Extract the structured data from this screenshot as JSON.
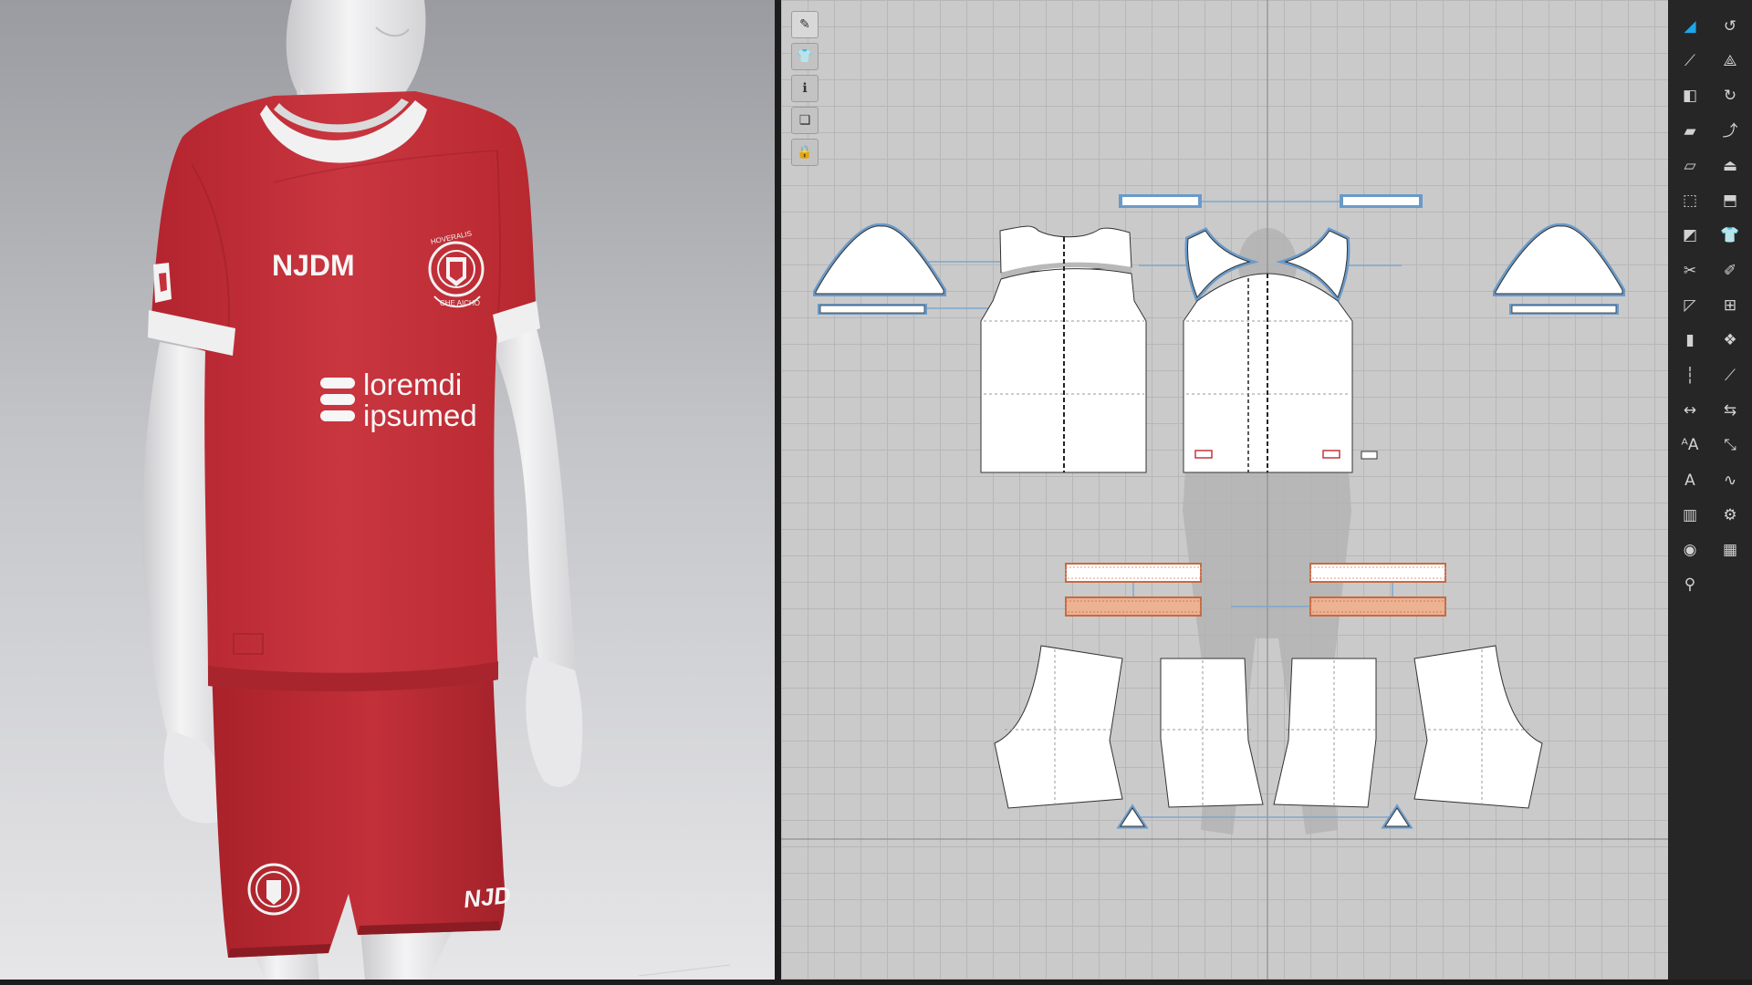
{
  "garment_3d": {
    "sponsor_chest": "NJDM",
    "sponsor_main_line1": "loremdi",
    "sponsor_main_line2": "ipsumed",
    "shorts_print": "NJD",
    "crest_text_top": "HOVERALIS",
    "crest_text_bottom": "CHE AICHO",
    "colors": {
      "fabric": "#c5313b",
      "fabric_dark": "#9e2029",
      "rib": "#eeeeee",
      "body": "#e4e4e6"
    }
  },
  "tools_2d": [
    {
      "name": "edit-pattern",
      "icon": "pen-icon",
      "glyph": "✎",
      "active": true
    },
    {
      "name": "garment-view",
      "icon": "shirt-icon",
      "glyph": "👕",
      "active": false
    },
    {
      "name": "info",
      "icon": "info-icon",
      "glyph": "ℹ",
      "active": false
    },
    {
      "name": "layers",
      "icon": "layers-icon",
      "glyph": "❏",
      "active": false
    },
    {
      "name": "lock",
      "icon": "lock-icon",
      "glyph": "🔒",
      "active": false
    }
  ],
  "tools_right": {
    "left_column": [
      {
        "icon": "select-pattern-icon",
        "glyph": "◢",
        "active": true
      },
      {
        "icon": "transform-icon",
        "glyph": "⟋",
        "active": false
      },
      {
        "icon": "polygon-icon",
        "glyph": "◧",
        "active": false
      },
      {
        "icon": "rectangle-icon",
        "glyph": "▰",
        "active": false
      },
      {
        "icon": "internal-shape-icon",
        "glyph": "▱",
        "active": false
      },
      {
        "icon": "dashed-rect-icon",
        "glyph": "⬚",
        "active": false
      },
      {
        "icon": "cut-pattern-icon",
        "glyph": "◩",
        "active": false
      },
      {
        "icon": "scissors-icon",
        "glyph": "✂",
        "active": false
      },
      {
        "icon": "dart-icon",
        "glyph": "◸",
        "active": false
      },
      {
        "icon": "fold-icon",
        "glyph": "▮",
        "active": false
      },
      {
        "icon": "ruler-vertical-icon",
        "glyph": "┆",
        "active": false
      },
      {
        "icon": "measure-icon",
        "glyph": "↔",
        "active": false
      },
      {
        "icon": "annotation-a-icon",
        "glyph": "ᴬA",
        "active": false
      },
      {
        "icon": "text-tool-icon",
        "glyph": "A",
        "active": false
      },
      {
        "icon": "grid-pattern-icon",
        "glyph": "▥",
        "active": false
      },
      {
        "icon": "button-icon",
        "glyph": "◉",
        "active": false
      },
      {
        "icon": "pin-icon",
        "glyph": "⚲",
        "active": false
      }
    ],
    "right_column": [
      {
        "icon": "move-pattern-icon",
        "glyph": "↺",
        "active": false
      },
      {
        "icon": "curve-point-icon",
        "glyph": "⟁",
        "active": false
      },
      {
        "icon": "rotate-icon",
        "glyph": "↻",
        "active": false
      },
      {
        "icon": "arrange-icon",
        "glyph": "⤴",
        "active": false
      },
      {
        "icon": "iron-icon",
        "glyph": "⏏",
        "active": false
      },
      {
        "icon": "fabric-icon",
        "glyph": "⬒",
        "active": false
      },
      {
        "icon": "shirt-tool-icon",
        "glyph": "👕",
        "active": false
      },
      {
        "icon": "brush-icon",
        "glyph": "✐",
        "active": false
      },
      {
        "icon": "mesh-icon",
        "glyph": "⊞",
        "active": false
      },
      {
        "icon": "group-icon",
        "glyph": "❖",
        "active": false
      },
      {
        "icon": "line-tool-icon",
        "glyph": "⟋",
        "active": false
      },
      {
        "icon": "seam-icon",
        "glyph": "⇆",
        "active": false
      },
      {
        "icon": "sewing-icon",
        "glyph": "⤡",
        "active": false
      },
      {
        "icon": "topstitch-icon",
        "glyph": "∿",
        "active": false
      },
      {
        "icon": "trim-icon",
        "glyph": "⚙",
        "active": false
      },
      {
        "icon": "table-icon",
        "glyph": "▦",
        "active": false
      }
    ]
  }
}
